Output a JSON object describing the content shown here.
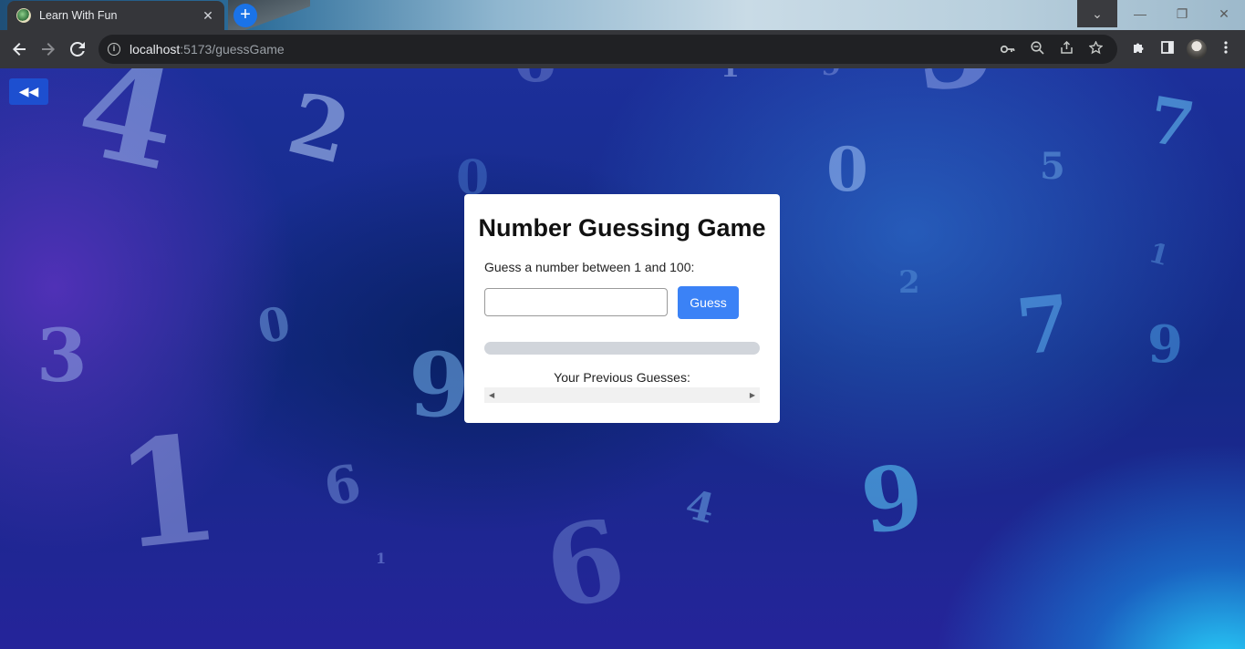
{
  "browser": {
    "tab_title": "Learn With Fun",
    "tab_close": "✕",
    "new_tab": "+",
    "url_host": "localhost",
    "url_path": ":5173/guessGame",
    "window_controls": {
      "dropdown": "⌄",
      "minimize": "—",
      "restore": "❐",
      "close": "✕"
    }
  },
  "page": {
    "back_button": "◀◀",
    "background_digits": [
      "4",
      "2",
      "3",
      "0",
      "9",
      "1",
      "6",
      "1",
      "6",
      "4",
      "0",
      "5",
      "7",
      "1",
      "2",
      "7",
      "9",
      "9",
      "6",
      "0",
      "1",
      "9",
      "5",
      "3"
    ]
  },
  "game": {
    "title": "Number Guessing Game",
    "prompt": "Guess a number between 1 and 100:",
    "input_value": "",
    "input_placeholder": "",
    "guess_button": "Guess",
    "progress": 0,
    "previous_label": "Your Previous Guesses:",
    "previous_guesses": []
  },
  "colors": {
    "accent": "#3b82f6",
    "back_button": "#1d4fd0",
    "progress_track": "#d1d5db"
  }
}
